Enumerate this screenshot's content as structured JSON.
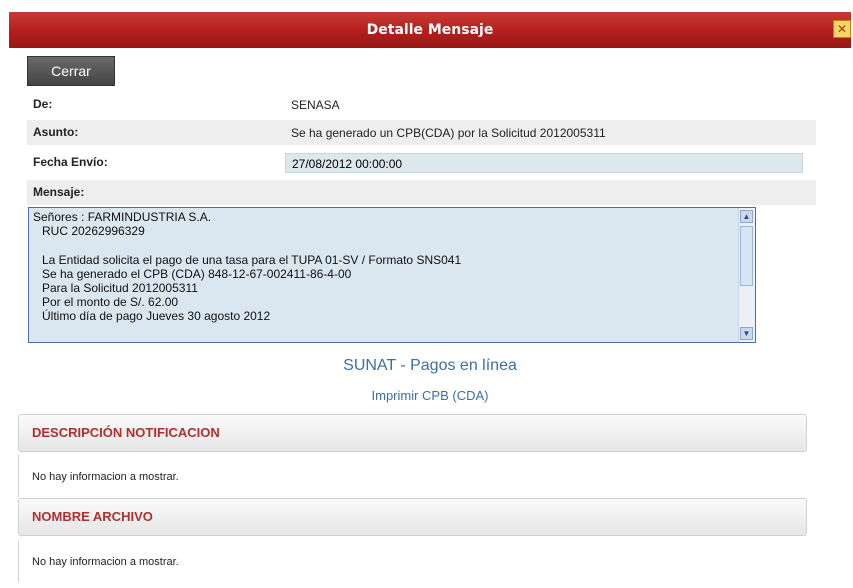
{
  "dialog": {
    "title": "Detalle Mensaje",
    "close_icon": "close-icon"
  },
  "buttons": {
    "cerrar": "Cerrar"
  },
  "fields": {
    "de_label": "De:",
    "de_value": "SENASA",
    "asunto_label": "Asunto:",
    "asunto_value": "Se ha generado un CPB(CDA) por la Solicitud 2012005311",
    "fecha_label": "Fecha Envío:",
    "fecha_value": "27/08/2012 00:00:00",
    "mensaje_label": "Mensaje:"
  },
  "message_lines": [
    "Señores : FARMINDUSTRIA S.A.",
    "RUC 20262996329",
    "",
    "La Entidad solicita el pago de una tasa para el TUPA 01-SV / Formato SNS041",
    "Se ha generado el CPB (CDA) 848-12-67-002411-86-4-00",
    "Para la Solicitud 2012005311",
    "Por el monto de  S/. 62.00",
    "Último día de pago Jueves 30 agosto 2012"
  ],
  "links": {
    "sunat": "SUNAT - Pagos en línea",
    "imprimir": "Imprimir CPB (CDA)"
  },
  "sections": [
    {
      "title": "DESCRIPCIÓN NOTIFICACION",
      "body": "No hay informacion a mostrar."
    },
    {
      "title": "NOMBRE ARCHIVO",
      "body": "No hay informacion a mostrar."
    }
  ],
  "colors": {
    "titlebar": "#b21f1d",
    "section_title": "#b03030",
    "link": "#3d6f9d"
  }
}
